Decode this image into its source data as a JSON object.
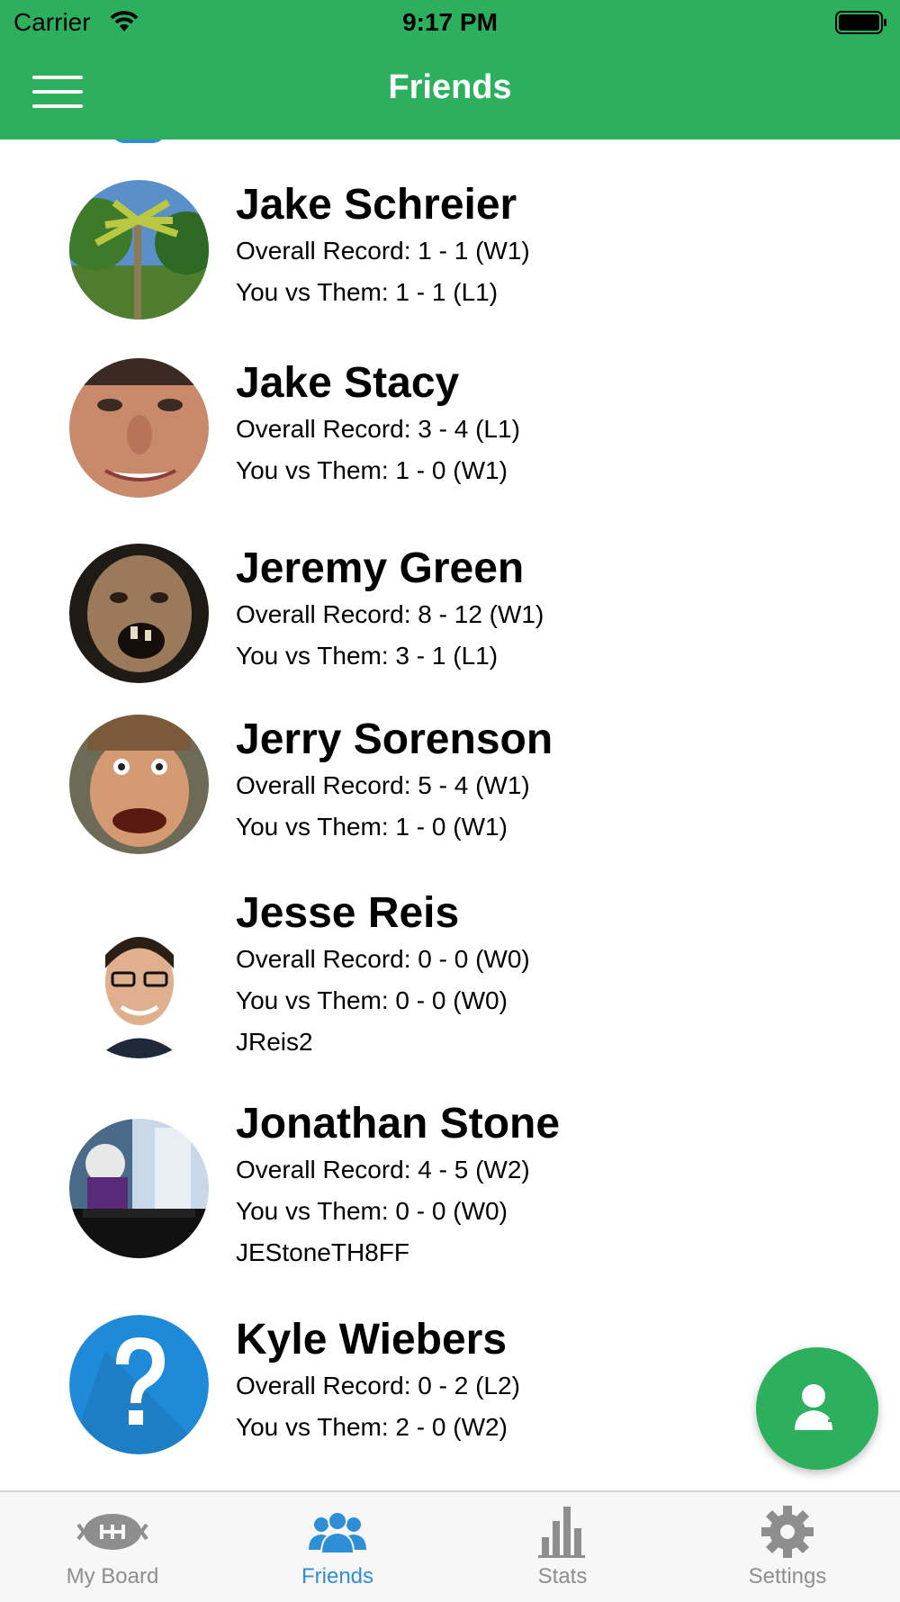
{
  "status_bar": {
    "carrier": "Carrier",
    "time": "9:17 PM"
  },
  "header": {
    "title": "Friends"
  },
  "friends": [
    {
      "name": "Jake Schreier",
      "overall": "Overall Record: 1 - 1 (W1)",
      "vs": "You vs Them: 1 - 1 (L1)",
      "username": "",
      "avatar": "palm-tree-photo"
    },
    {
      "name": "Jake Stacy",
      "overall": "Overall Record: 3 - 4 (L1)",
      "vs": "You vs Them: 1 - 0 (W1)",
      "username": "",
      "avatar": "face-photo"
    },
    {
      "name": "Jeremy Green",
      "overall": "Overall Record: 8 - 12 (W1)",
      "vs": "You vs Them: 3 - 1 (L1)",
      "username": "",
      "avatar": "monster-photo"
    },
    {
      "name": "Jerry Sorenson",
      "overall": "Overall Record: 5 - 4 (W1)",
      "vs": "You vs Them: 1 - 0 (W1)",
      "username": "",
      "avatar": "face-photo"
    },
    {
      "name": "Jesse Reis",
      "overall": "Overall Record: 0 - 0 (W0)",
      "vs": "You vs Them: 0 - 0 (W0)",
      "username": "JReis2",
      "avatar": "portrait-photo"
    },
    {
      "name": "Jonathan Stone",
      "overall": "Overall Record: 4 - 5 (W2)",
      "vs": "You vs Them: 0 - 0 (W0)",
      "username": "JEStoneTH8FF",
      "avatar": "tv-photo"
    },
    {
      "name": "Kyle Wiebers",
      "overall": "Overall Record: 0 - 2 (L2)",
      "vs": "You vs Them: 2 - 0 (W2)",
      "username": "",
      "avatar": "question-mark-icon"
    }
  ],
  "tabs": [
    {
      "label": "My Board",
      "icon": "football-icon",
      "active": false
    },
    {
      "label": "Friends",
      "icon": "friends-icon",
      "active": true
    },
    {
      "label": "Stats",
      "icon": "bar-chart-icon",
      "active": false
    },
    {
      "label": "Settings",
      "icon": "gear-icon",
      "active": false
    }
  ],
  "colors": {
    "brand_green": "#2db05e",
    "tab_active": "#2f8fd6",
    "tab_inactive": "#8e8e8e"
  }
}
